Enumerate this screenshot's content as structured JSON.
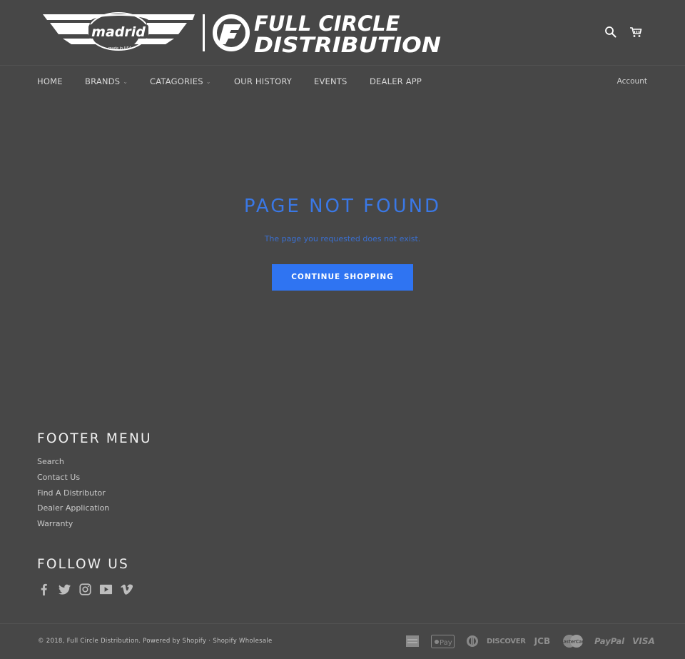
{
  "header": {
    "logo_left_text": "madrid",
    "logo_left_subtext": "made in USA",
    "logo_right_line1": "FULL CIRCLE",
    "logo_right_line2": "DISTRIBUTION",
    "icons": [
      "search-icon",
      "cart-icon"
    ]
  },
  "nav": {
    "items": [
      {
        "label": "HOME",
        "dropdown": false
      },
      {
        "label": "BRANDS",
        "dropdown": true
      },
      {
        "label": "CATAGORIES",
        "dropdown": true
      },
      {
        "label": "OUR HISTORY",
        "dropdown": false
      },
      {
        "label": "EVENTS",
        "dropdown": false
      },
      {
        "label": "DEALER APP",
        "dropdown": false
      }
    ],
    "chevron": "⌄",
    "account_label": "Account"
  },
  "main": {
    "title": "PAGE NOT FOUND",
    "subtitle": "The page you requested does not exist.",
    "button_label": "CONTINUE SHOPPING",
    "accent_color": "#2f74f2"
  },
  "footer": {
    "menu_title": "FOOTER MENU",
    "menu_items": [
      "Search",
      "Contact Us",
      "Find A Distributor",
      "Dealer Application",
      "Warranty"
    ],
    "follow_title": "FOLLOW US",
    "social_icons": [
      "facebook-icon",
      "twitter-icon",
      "instagram-icon",
      "youtube-icon",
      "vimeo-icon"
    ],
    "copyright_prefix": "© 2018,",
    "copyright_company": "Full Circle Distribution",
    "powered_by": "Powered by Shopify",
    "separator": "·",
    "wholesale": "Shopify Wholesale",
    "payments": {
      "amex": "AMEX",
      "applepay": "Pay",
      "diners": "",
      "discover": "DISCOVER",
      "jcb": "JCB",
      "mastercard": "MasterCard",
      "paypal": "PayPal",
      "visa": "VISA"
    }
  },
  "colors": {
    "background": "#474747",
    "accent": "#2f74f2",
    "title_blue": "#3a78e6"
  }
}
